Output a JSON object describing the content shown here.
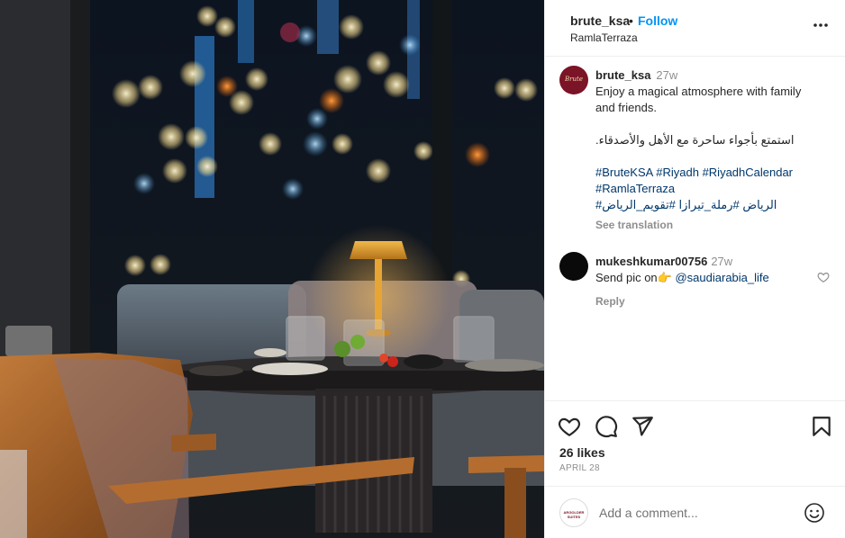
{
  "post": {
    "username": "brute_ksa",
    "separator": "•",
    "follow_label": "Follow",
    "location": "RamlaTerraza",
    "avatar_text": "Brute"
  },
  "caption": {
    "username": "brute_ksa",
    "time": "27w",
    "text_en_1": "Enjoy a magical atmosphere with family",
    "text_en_2": "and friends.",
    "text_ar": "استمتع بأجواء ساحرة مع الأهل والأصدقاء.",
    "tags_line1": [
      "#BruteKSA",
      "#Riyadh",
      "#RiyadhCalendar"
    ],
    "tags_line2": [
      "#RamlaTerraza"
    ],
    "tags_line3": [
      "#الرياض",
      "#رملة_تيرازا",
      "#تقويم_الرياض"
    ],
    "see_translation": "See translation"
  },
  "comment": {
    "username": "mukeshkumar00756",
    "time": "27w",
    "text": "Send pic on",
    "emoji": "👉",
    "mention": "@saudiarabia_life",
    "reply_label": "Reply"
  },
  "stats": {
    "likes": "26 likes",
    "date": "APRIL 28"
  },
  "add_comment": {
    "placeholder": "Add a comment...",
    "avatar_text": "ARGOLDER SUITES"
  },
  "icons": {
    "more": "more-options-icon",
    "like": "heart-icon",
    "comment": "comment-icon",
    "share": "share-icon",
    "save": "bookmark-icon",
    "emoji": "emoji-icon"
  },
  "colors": {
    "follow": "#0095f6",
    "hashtag": "#00376b",
    "muted": "#8e8e8e",
    "brand_avatar": "#7a1426"
  }
}
